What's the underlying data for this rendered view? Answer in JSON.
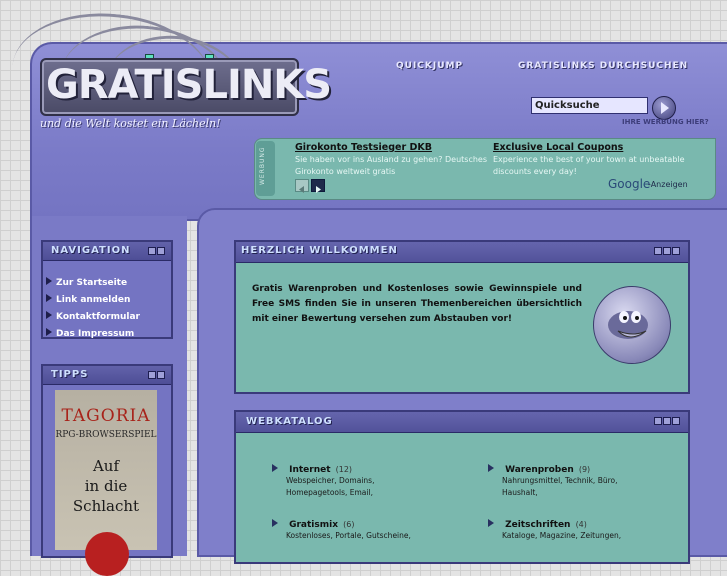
{
  "header": {
    "logo": "GRATISLINKS",
    "slogan": "und die Welt kostet ein Lächeln!",
    "quickjump": "QUICKJUMP",
    "search_link": "GRATISLINKS DURCHSUCHEN",
    "search_value": "Quicksuche",
    "ad_hint": "IHRE WERBUNG HIER?"
  },
  "ads": {
    "side_label": "WERBUNG",
    "items": [
      {
        "title": "Girokonto Testsieger DKB",
        "text": "Sie haben vor ins Ausland zu gehen? Deutsches Girokonto weltweit gratis"
      },
      {
        "title": "Exclusive Local Coupons",
        "text": "Experience the best of your town at unbeatable discounts every day!"
      }
    ],
    "google": "Google",
    "anzeigen": "-Anzeigen"
  },
  "navigation": {
    "title": "NAVIGATION",
    "items": [
      "Zur Startseite",
      "Link anmelden",
      "Kontaktformular",
      "Das Impressum"
    ]
  },
  "tipps": {
    "title": "TIPPS",
    "banner_name": "TAGORIA",
    "banner_sub": "RPG-BROWSERSPIEL",
    "banner_lines": [
      "Auf",
      "in die",
      "Schlacht"
    ]
  },
  "welcome": {
    "title": "HERZLICH WILLKOMMEN",
    "text": "Gratis Warenproben und Kostenloses sowie Gewinnspiele und Free SMS finden Sie in unseren Themenbereichen übersichtlich mit einer Bewertung versehen zum Abstauben vor!"
  },
  "catalog": {
    "title": "WEBKATALOG",
    "categories": [
      {
        "name": "Internet",
        "count": "(12)",
        "subs": [
          "Webspeicher, Domains,",
          "Homepagetools, Email,"
        ]
      },
      {
        "name": "Warenproben",
        "count": "(9)",
        "subs": [
          "Nahrungsmittel, Technik, Büro,",
          "Haushalt,"
        ]
      },
      {
        "name": "Gratismix",
        "count": "(6)",
        "subs": [
          "Kostenloses, Portale, Gutscheine,"
        ]
      },
      {
        "name": "Zeitschriften",
        "count": "(4)",
        "subs": [
          "Kataloge, Magazine, Zeitungen,"
        ]
      }
    ]
  },
  "colors": {
    "accent": "#7474c2",
    "teal": "#7ab8ae",
    "border": "#3a3a7a"
  }
}
